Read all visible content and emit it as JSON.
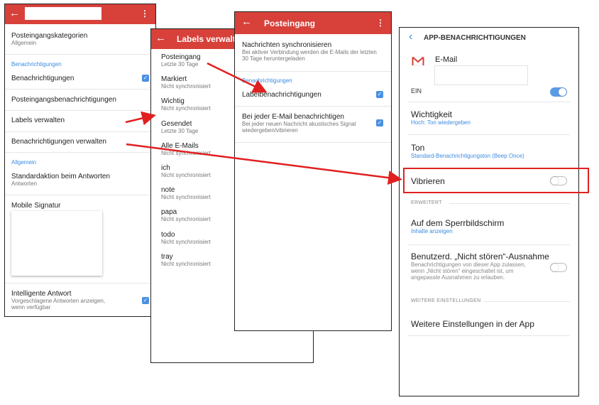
{
  "panel1": {
    "header": {
      "back_icon": "arrow-left-icon",
      "more_icon": "more-vert-icon"
    },
    "items": {
      "inbox_categories": {
        "title": "Posteingangskategorien",
        "sub": "Allgemein"
      },
      "section_notifications": "Benachrichtigungen",
      "notifications": {
        "title": "Benachrichtigungen",
        "checked": true
      },
      "inbox_notifications": {
        "title": "Posteingangsbenachrichtigungen"
      },
      "manage_labels": {
        "title": "Labels verwalten"
      },
      "manage_notifications": {
        "title": "Benachrichtigungen verwalten"
      },
      "section_general": "Allgemein",
      "default_action": {
        "title": "Standardaktion beim Antworten",
        "sub": "Antworten"
      },
      "mobile_signature": {
        "title": "Mobile Signatur"
      },
      "smart_reply": {
        "title": "Intelligente Antwort",
        "sub1": "Vorgeschlagene Antworten anzeigen,",
        "sub2": "wenn verfügbar",
        "checked": true
      }
    }
  },
  "panel2": {
    "header": {
      "title": "Labels verwalte",
      "back_icon": "arrow-left-icon"
    },
    "labels": [
      {
        "name": "Posteingang",
        "sub": "Letzte 30 Tage"
      },
      {
        "name": "Markiert",
        "sub": "Nicht synchronisiert"
      },
      {
        "name": "Wichtig",
        "sub": "Nicht synchronisiert"
      },
      {
        "name": "Gesendet",
        "sub": "Letzte 30 Tage"
      },
      {
        "name": "Alle E-Mails",
        "sub": "Nicht synchronisiert"
      },
      {
        "name": "ich",
        "sub": "Nicht synchronisiert"
      },
      {
        "name": "note",
        "sub": "Nicht synchronisiert"
      },
      {
        "name": "papa",
        "sub": "Nicht synchronisiert"
      },
      {
        "name": "todo",
        "sub": "Nicht synchronisiert"
      },
      {
        "name": "tray",
        "sub": "Nicht synchronisiert"
      }
    ]
  },
  "panel3": {
    "header": {
      "title": "Posteingang",
      "back_icon": "arrow-left-icon",
      "more_icon": "more-vert-icon"
    },
    "sync": {
      "title": "Nachrichten synchronisieren",
      "sub1": "Bei aktiver Verbindung werden die E-Mails der letzten",
      "sub2": "30 Tage heruntergeladen"
    },
    "section": "Benachrichtigungen",
    "label_notifications": {
      "title": "Labelbenachrichtigungen",
      "checked": true
    },
    "every_email": {
      "title": "Bei jeder E-Mail benachrichtigen",
      "sub1": "Bei jeder neuen Nachricht akustisches Signal",
      "sub2": "wiedergeben/vibrieren",
      "checked": true
    }
  },
  "panel4": {
    "header": {
      "title": "APP-BENACHRICHTIGUNGEN",
      "back_icon": "chevron-left-icon"
    },
    "app": {
      "name": "E-Mail",
      "icon": "gmail-icon"
    },
    "ein": {
      "label": "EIN",
      "on": true
    },
    "importance": {
      "title": "Wichtigkeit",
      "sub": "Hoch: Ton wiedergeben"
    },
    "sound": {
      "title": "Ton",
      "sub": "Standard-Benachrichtigungston (Beep Once)"
    },
    "vibrate": {
      "title": "Vibrieren",
      "on": false
    },
    "advanced_header": "ERWEITERT",
    "lockscreen": {
      "title": "Auf dem Sperrbildschirm",
      "sub": "Inhalte anzeigen"
    },
    "dnd": {
      "title": "Benutzerd. „Nicht stören“-Ausnahme",
      "sub1": "Benachrichtigungen von dieser App zulassen,",
      "sub2": "wenn „Nicht stören“ eingeschaltet ist, um",
      "sub3": "angepasste Ausnahmen zu erlauben.",
      "on": false
    },
    "more_header": "WEITERE EINSTELLUNGEN",
    "more_settings": {
      "title": "Weitere Einstellungen in der App"
    }
  },
  "colors": {
    "accent_red": "#d8403a",
    "check_blue": "#4a90e2",
    "link_blue": "#3b8be0",
    "arrow_red": "#e02020"
  }
}
